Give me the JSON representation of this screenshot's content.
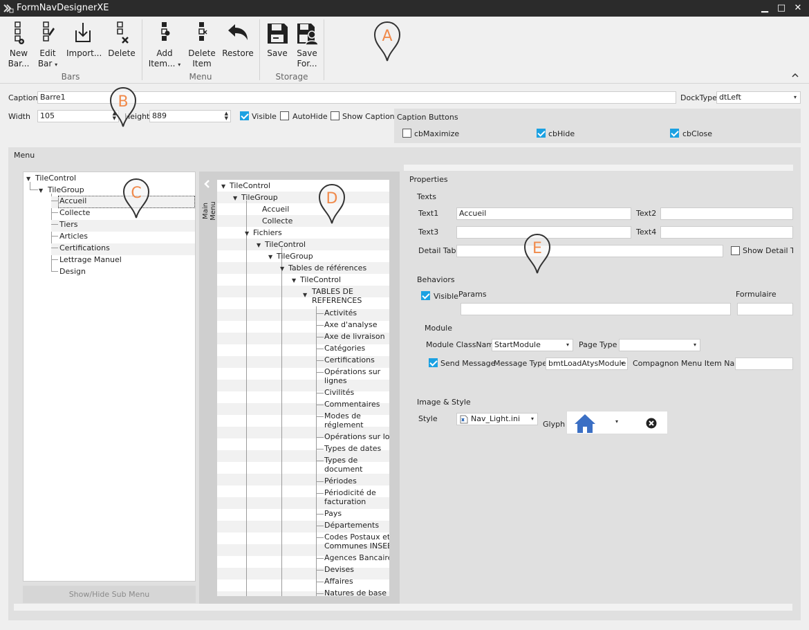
{
  "window": {
    "title": "FormNavDesignerXE",
    "minimize": "▁",
    "maximize": "□",
    "close": "✕"
  },
  "ribbon": {
    "groups": [
      {
        "label": "Bars"
      },
      {
        "label": "Menu"
      },
      {
        "label": "Storage"
      }
    ],
    "buttons": {
      "new_bar": [
        "New",
        "Bar..."
      ],
      "edit_bar": [
        "Edit",
        "Bar"
      ],
      "import": "Import...",
      "delete": "Delete",
      "add_item": [
        "Add",
        "Item..."
      ],
      "delete_item": [
        "Delete",
        "Item"
      ],
      "restore": "Restore",
      "save": "Save",
      "save_for": [
        "Save",
        "For..."
      ]
    },
    "collapse": "^"
  },
  "props": {
    "caption_label": "Caption",
    "caption_value": "Barre1",
    "docktype_label": "DockType",
    "docktype_value": "dtLeft",
    "width_label": "Width",
    "width_value": "105",
    "height_label": "Height",
    "height_value": "889",
    "visible_label": "Visible",
    "visible_checked": true,
    "autohide_label": "AutoHide",
    "autohide_checked": false,
    "showcaption_label": "Show Caption",
    "showcaption_checked": false,
    "caption_buttons": {
      "title": "Caption Buttons",
      "items": [
        {
          "label": "cbMaximize",
          "checked": false
        },
        {
          "label": "cbHide",
          "checked": true
        },
        {
          "label": "cbClose",
          "checked": true
        }
      ]
    }
  },
  "menu_panel": {
    "title": "Menu",
    "tree_c": {
      "root": "TileControl",
      "group": "TileGroup",
      "items": [
        "Accueil",
        "Collecte",
        "Tiers",
        "Articles",
        "Certifications",
        "Lettrage Manuel",
        "Design"
      ]
    },
    "show_hide_button": "Show/Hide Sub Menu",
    "main_menu_label": "Main Menu",
    "tree_d": {
      "root": "TileControl",
      "group": "TileGroup",
      "items_top": [
        "Accueil",
        "Collecte"
      ],
      "fichiers": "Fichiers",
      "sub_control": "TileControl",
      "sub_group": "TileGroup",
      "tables": "Tables de références",
      "tables_control": "TileControl",
      "tables_ref": [
        "TABLES DE",
        "REFERENCES"
      ],
      "leaves": [
        [
          "Activités"
        ],
        [
          "Axe d'analyse"
        ],
        [
          "Axe de livraison"
        ],
        [
          "Catégories"
        ],
        [
          "Certifications"
        ],
        [
          "Opérations sur",
          "lignes"
        ],
        [
          "Civilités"
        ],
        [
          "Commentaires"
        ],
        [
          "Modes de",
          "réglement"
        ],
        [
          "Opérations sur lots"
        ],
        [
          "Types de dates"
        ],
        [
          "Types de",
          "document"
        ],
        [
          "Périodes"
        ],
        [
          "Périodicité de",
          "facturation"
        ],
        [
          "Pays"
        ],
        [
          "Départements"
        ],
        [
          "Codes Postaux et",
          "Communes INSEE"
        ],
        [
          "Agences Bancaires"
        ],
        [
          "Devises"
        ],
        [
          "Affaires"
        ],
        [
          "Natures de base"
        ]
      ]
    }
  },
  "properties": {
    "title": "Properties",
    "texts": {
      "title": "Texts",
      "text1_label": "Text1",
      "text1_value": "Accueil",
      "text2_label": "Text2",
      "text2_value": "",
      "text3_label": "Text3",
      "text3_value": "",
      "text4_label": "Text4",
      "text4_value": "",
      "detail_tab_label": "Detail Tab",
      "detail_tab_value": "",
      "show_detail_label": "Show Detail Tal"
    },
    "behaviors": {
      "title": "Behaviors",
      "visible_label": "Visible",
      "params_label": "Params",
      "formulaire_label": "Formulaire",
      "module_title": "Module",
      "module_classname_label": "Module ClassName",
      "module_classname_value": "StartModule",
      "page_type_label": "Page Type",
      "page_type_value": "",
      "send_message_label": "Send Message",
      "message_type_label": "Message Type",
      "message_type_value": "bmtLoadAtysModule",
      "compagnon_label": "Compagnon Menu Item Name",
      "compagnon_value": ""
    },
    "image_style": {
      "title": "Image & Style",
      "style_label": "Style",
      "style_value": "Nav_Light.ini",
      "glyph_label": "Glyph",
      "glyph_icon": "home-icon",
      "clear_icon": "clear-circle-icon"
    }
  },
  "callouts": [
    "A",
    "B",
    "C",
    "D",
    "E"
  ],
  "colors": {
    "accent": "#1ba1e2",
    "callout": "#f08a4b",
    "titlebar": "#2b2b2b",
    "home_icon": "#3b6fc4"
  }
}
